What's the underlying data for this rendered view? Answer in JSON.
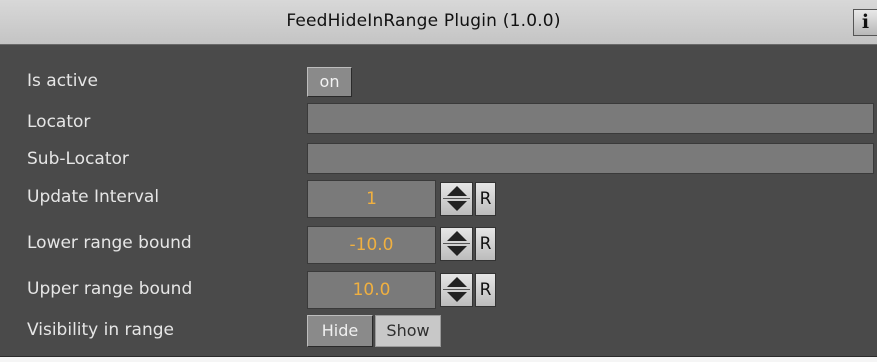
{
  "title": "FeedHideInRange Plugin (1.0.0)",
  "info_button": "i",
  "rows": {
    "is_active": {
      "label": "Is active",
      "value": "on"
    },
    "locator": {
      "label": "Locator",
      "value": ""
    },
    "sub_locator": {
      "label": "Sub-Locator",
      "value": ""
    },
    "update_interval": {
      "label": "Update Interval",
      "value": "1",
      "reset": "R"
    },
    "lower_bound": {
      "label": "Lower range bound",
      "value": "-10.0",
      "reset": "R"
    },
    "upper_bound": {
      "label": "Upper range bound",
      "value": "10.0",
      "reset": "R"
    },
    "visibility": {
      "label": "Visibility in range",
      "options": [
        "Hide",
        "Show"
      ],
      "selected": "Hide"
    }
  },
  "colors": {
    "panel_bg": "#4a4a4a",
    "field_bg": "#7a7a7a",
    "value_text": "#f0b040",
    "label_text": "#e6e6e6"
  },
  "icons": {
    "info": "info-icon",
    "spinner": "up-down-arrows-icon"
  }
}
